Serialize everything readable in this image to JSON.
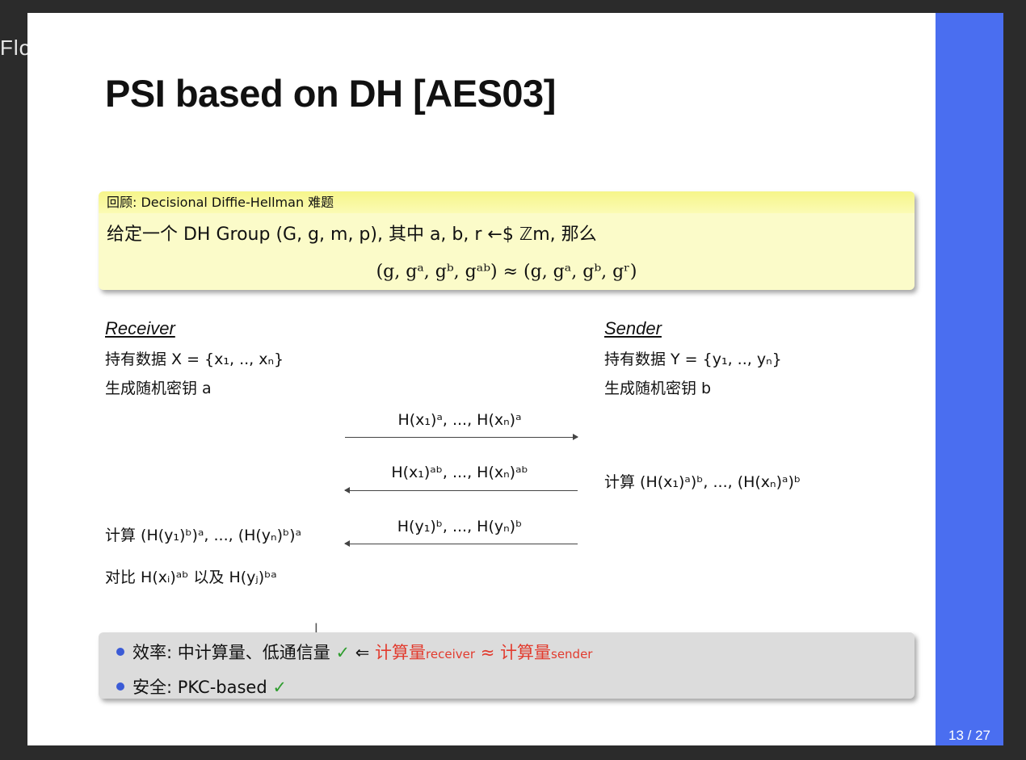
{
  "watermark": {
    "text": "Flow",
    "logo": "bilibili"
  },
  "slide": {
    "title": "PSI based on DH [AES03]",
    "page_number": "13 / 27",
    "accent_color": "#4a6ef0",
    "block": {
      "title": "回顾: Decisional Diffie-Hellman 难题",
      "line1": "给定一个 DH Group (G, g, m, p), 其中 a, b, r ←$ ℤm, 那么",
      "line2": "(g, gᵃ, gᵇ, gᵃᵇ) ≈ (g, gᵃ, gᵇ, gʳ)"
    },
    "receiver": {
      "title": "Receiver",
      "data": "持有数据 X = {x₁, .., xₙ}",
      "key": "生成随机密钥 a",
      "compute": "计算 (H(y₁)ᵇ)ᵃ, ..., (H(yₙ)ᵇ)ᵃ",
      "compare": "对比 H(xᵢ)ᵃᵇ 以及 H(yⱼ)ᵇᵃ"
    },
    "sender": {
      "title": "Sender",
      "data": "持有数据 Y = {y₁, .., yₙ}",
      "key": "生成随机密钥 b",
      "compute": "计算 (H(x₁)ᵃ)ᵇ, ..., (H(xₙ)ᵃ)ᵇ"
    },
    "messages": [
      "H(x₁)ᵃ, ..., H(xₙ)ᵃ",
      "H(x₁)ᵃᵇ, ..., H(xₙ)ᵃᵇ",
      "H(y₁)ᵇ, ..., H(yₙ)ᵇ"
    ],
    "summary": {
      "efficiency_label": "效率: 中计算量、低通信量",
      "efficiency_check": "✓",
      "implies": "⇐",
      "cost_label_1": "计算量",
      "cost_sub_1": "receiver",
      "approx": "≈",
      "cost_label_2": "计算量",
      "cost_sub_2": "sender",
      "security_label": "安全: PKC-based",
      "security_check": "✓"
    }
  }
}
